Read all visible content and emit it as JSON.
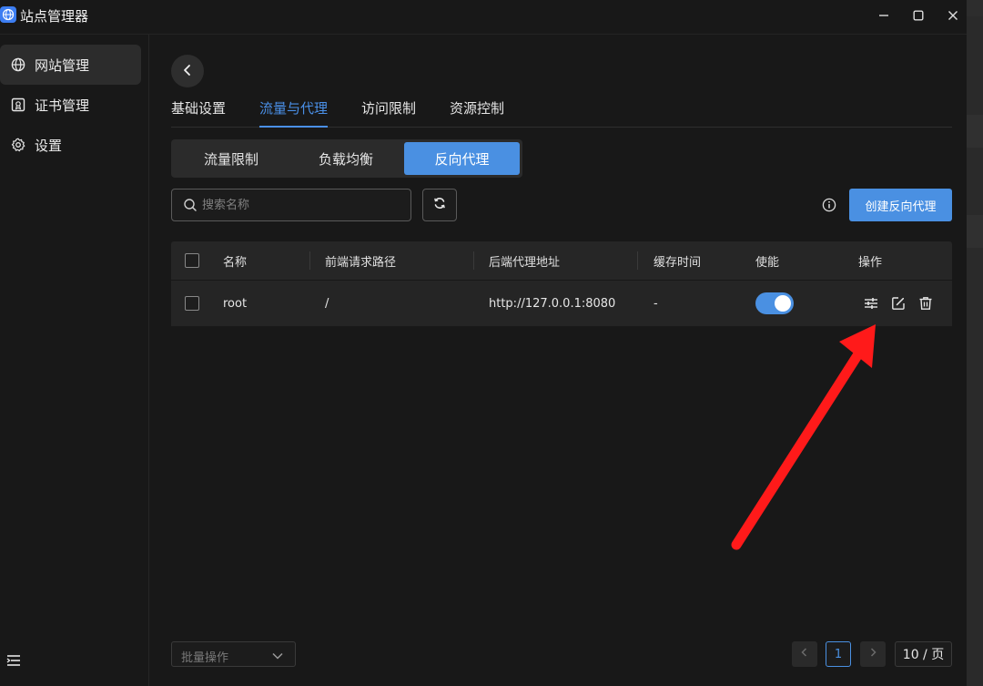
{
  "app": {
    "title": "站点管理器",
    "icon": "globe-icon",
    "accent": "#4a90e2"
  },
  "window_controls": [
    "minimize-icon",
    "maximize-icon",
    "close-icon"
  ],
  "sidebar": {
    "items": [
      {
        "label": "网站管理",
        "icon": "globe-icon",
        "active": true
      },
      {
        "label": "证书管理",
        "icon": "certificate-icon",
        "active": false
      },
      {
        "label": "设置",
        "icon": "gear-icon",
        "active": false
      }
    ]
  },
  "tabs": [
    {
      "label": "基础设置",
      "active": false
    },
    {
      "label": "流量与代理",
      "active": true
    },
    {
      "label": "访问限制",
      "active": false
    },
    {
      "label": "资源控制",
      "active": false
    }
  ],
  "segments": [
    {
      "label": "流量限制",
      "active": false
    },
    {
      "label": "负载均衡",
      "active": false
    },
    {
      "label": "反向代理",
      "active": true
    }
  ],
  "search": {
    "placeholder": "搜索名称",
    "value": ""
  },
  "create_button": "创建反向代理",
  "table": {
    "headers": [
      "名称",
      "前端请求路径",
      "后端代理地址",
      "缓存时间",
      "使能",
      "操作"
    ],
    "rows": [
      {
        "name": "root",
        "path": "/",
        "backend": "http://127.0.0.1:8080",
        "cache": "-",
        "enabled": true,
        "actions": [
          "sliders-icon",
          "edit-icon",
          "trash-icon"
        ]
      }
    ]
  },
  "footer": {
    "batch_label": "批量操作",
    "current_page": "1",
    "page_size": "10 / 页"
  },
  "annotation": {
    "color": "#ff1a1a",
    "points_to": "sliders-icon"
  }
}
